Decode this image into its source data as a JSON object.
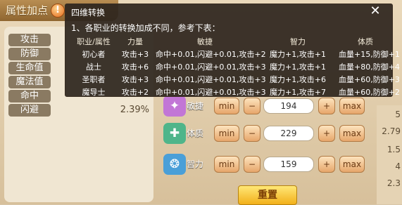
{
  "window": {
    "title": "属性加点"
  },
  "stats": [
    {
      "label": "攻击",
      "value": ""
    },
    {
      "label": "防御",
      "value": ""
    },
    {
      "label": "生命值",
      "value": ""
    },
    {
      "label": "魔法值",
      "value": ""
    },
    {
      "label": "命中",
      "value": ""
    },
    {
      "label": "闪避",
      "value": "2.39%"
    }
  ],
  "attributes": [
    {
      "name": "敏捷",
      "value": "194"
    },
    {
      "name": "体质",
      "value": "229"
    },
    {
      "name": "智力",
      "value": "159"
    }
  ],
  "controls": {
    "min": "min",
    "minus": "−",
    "plus": "+",
    "max": "max",
    "reset": "重置"
  },
  "right_values": [
    "5",
    "2.79",
    "1.5",
    "4",
    "2.3"
  ],
  "tooltip": {
    "title": "四维转换",
    "line": "1、各职业的转换加成不同，参考下表：",
    "headers": [
      "职业/属性",
      "力量",
      "敏捷",
      "智力",
      "体质"
    ],
    "rows": [
      [
        "初心者",
        "攻击+3",
        "命中+0.01,闪避+0.01,攻击+2",
        "魔力+1,攻击+1",
        "血量+15,防御+1"
      ],
      [
        "战士",
        "攻击+6",
        "命中+0.01,闪避+0.01,攻击+3",
        "魔力+1,攻击+1",
        "血量+80,防御+4"
      ],
      [
        "圣职者",
        "攻击+3",
        "命中+0.01,闪避+0.01,攻击+3",
        "魔力+1,攻击+6",
        "血量+60,防御+3"
      ],
      [
        "魔导士",
        "攻击+2",
        "命中+0.01,闪避+0.01,攻击+3",
        "魔力+1,攻击+7",
        "血量+60,防御+2"
      ]
    ]
  },
  "colors": {
    "accent": "#e7a66b",
    "tooltip_bg": "#2e261e",
    "reset": "#f2b01a"
  }
}
